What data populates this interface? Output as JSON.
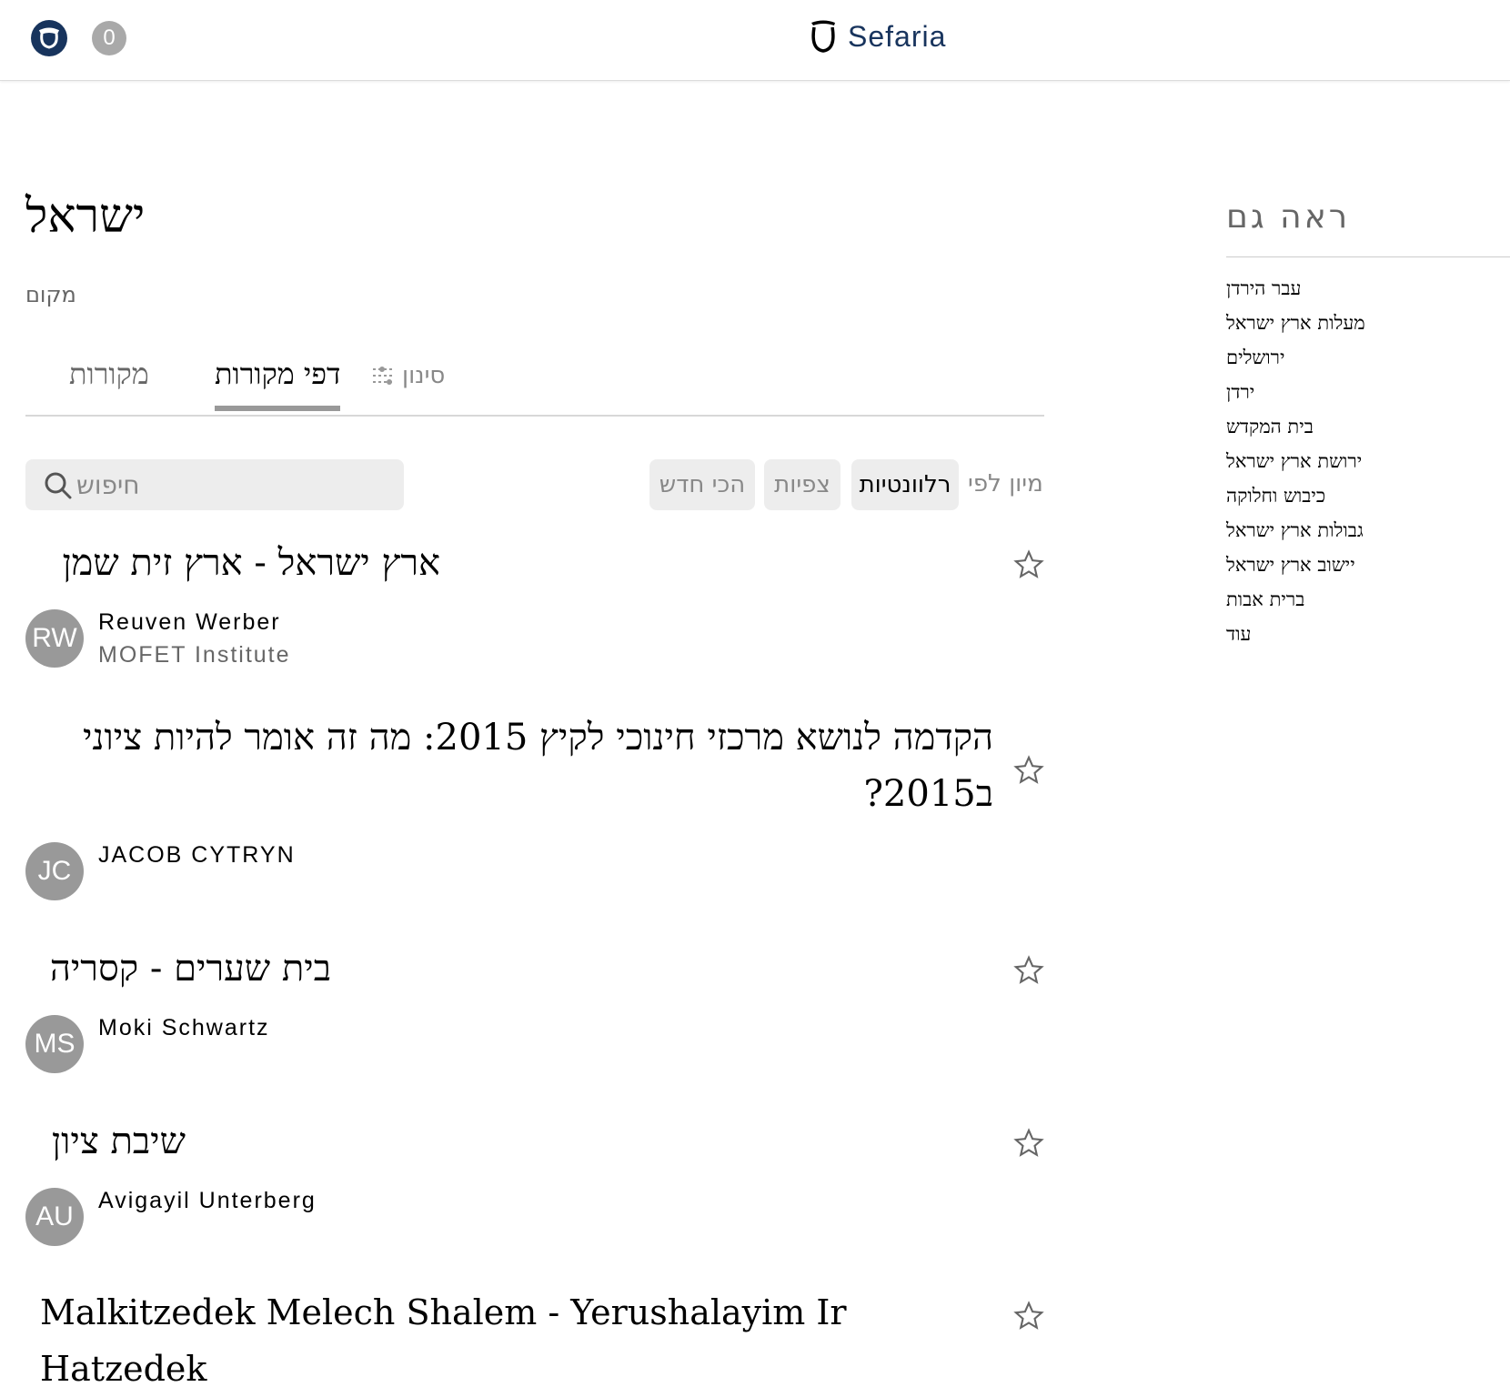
{
  "header": {
    "logo_text": "Sefaria",
    "notification_count": "0",
    "brand_color": "#18345d"
  },
  "topic": {
    "title": "ישראל",
    "type": "מקום"
  },
  "tabs": {
    "sources": "מקורות",
    "sheets": "דפי מקורות",
    "filter": "סינון"
  },
  "search": {
    "placeholder": "חיפוש"
  },
  "sort": {
    "label": "מיון לפי",
    "relevance": "רלוונטיות",
    "views": "צפיות",
    "newest": "הכי חדש"
  },
  "sheets": [
    {
      "title": "ארץ ישראל - ארץ זית שמן",
      "initials": "RW",
      "author": "Reuven Werber",
      "org": "MOFET Institute"
    },
    {
      "title": "הקדמה לנושא מרכזי חינוכי לקיץ 2015: מה זה אומר להיות ציוני ב2015?",
      "initials": "JC",
      "author": "JACOB CYTRYN",
      "org": ""
    },
    {
      "title": "בית שערים - קסריה",
      "initials": "MS",
      "author": "Moki Schwartz",
      "org": ""
    },
    {
      "title": "שיבת ציון",
      "initials": "AU",
      "author": "Avigayil Unterberg",
      "org": ""
    },
    {
      "title": "Malkitzedek Melech Shalem - Yerushalayim Ir Hatzedek",
      "initials": "",
      "author": "",
      "org": ""
    }
  ],
  "see_also": {
    "heading": "ראה גם",
    "items": [
      "עבר הירדן",
      "מעלות ארץ ישראל",
      "ירושלים",
      "ירדן",
      "בית המקדש",
      "ירושת ארץ ישראל",
      "כיבוש וחלוקה",
      "גבולות ארץ ישראל",
      "יישוב ארץ ישראל",
      "ברית אבות",
      "עוד"
    ]
  }
}
